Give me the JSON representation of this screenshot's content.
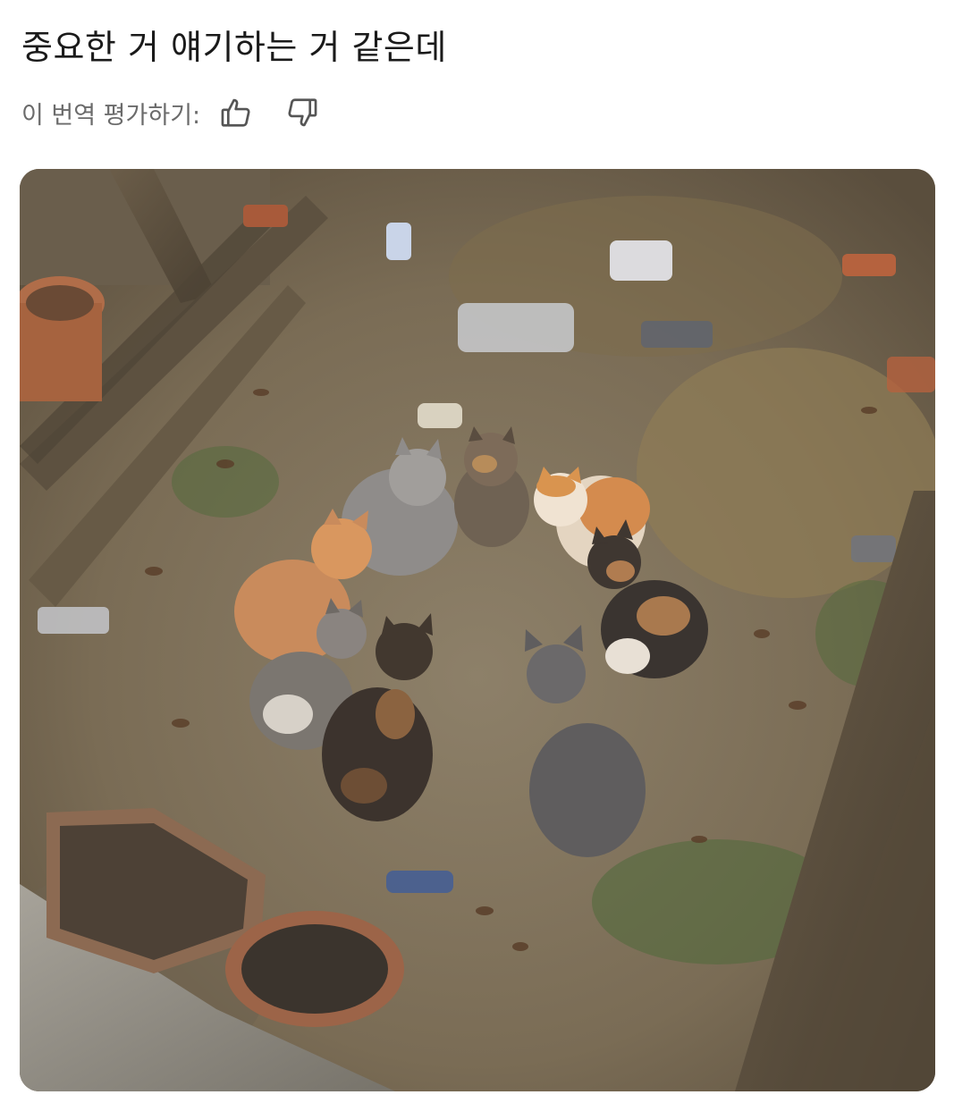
{
  "post": {
    "text": "중요한 거 얘기하는 거 같은데"
  },
  "translation_rating": {
    "label": "이 번역 평가하기:",
    "thumbs_up_icon": "thumbs-up-icon",
    "thumbs_down_icon": "thumbs-down-icon"
  },
  "media": {
    "kind": "photo",
    "subject": "photo"
  },
  "colors": {
    "text": "#1a1a1a",
    "muted": "#6b6b6b",
    "icon": "#555555",
    "background": "#ffffff"
  }
}
